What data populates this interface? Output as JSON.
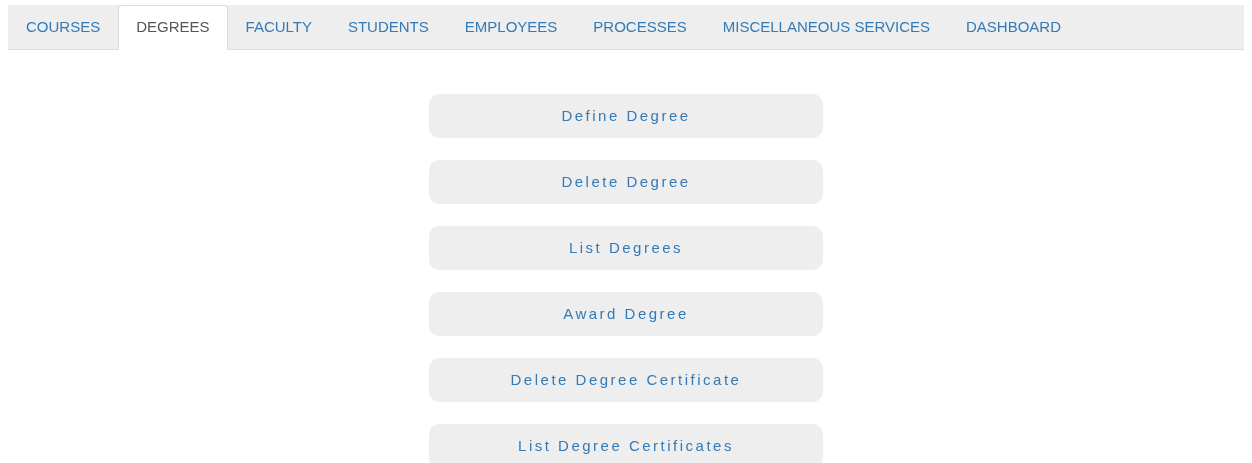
{
  "tabs": [
    {
      "label": "COURSES",
      "selected": false
    },
    {
      "label": "DEGREES",
      "selected": true
    },
    {
      "label": "FACULTY",
      "selected": false
    },
    {
      "label": "STUDENTS",
      "selected": false
    },
    {
      "label": "EMPLOYEES",
      "selected": false
    },
    {
      "label": "PROCESSES",
      "selected": false
    },
    {
      "label": "MISCELLANEOUS SERVICES",
      "selected": false
    },
    {
      "label": "DASHBOARD",
      "selected": false
    }
  ],
  "actions": [
    "Define Degree",
    "Delete Degree",
    "List Degrees",
    "Award Degree",
    "Delete Degree Certificate",
    "List Degree Certificates"
  ]
}
